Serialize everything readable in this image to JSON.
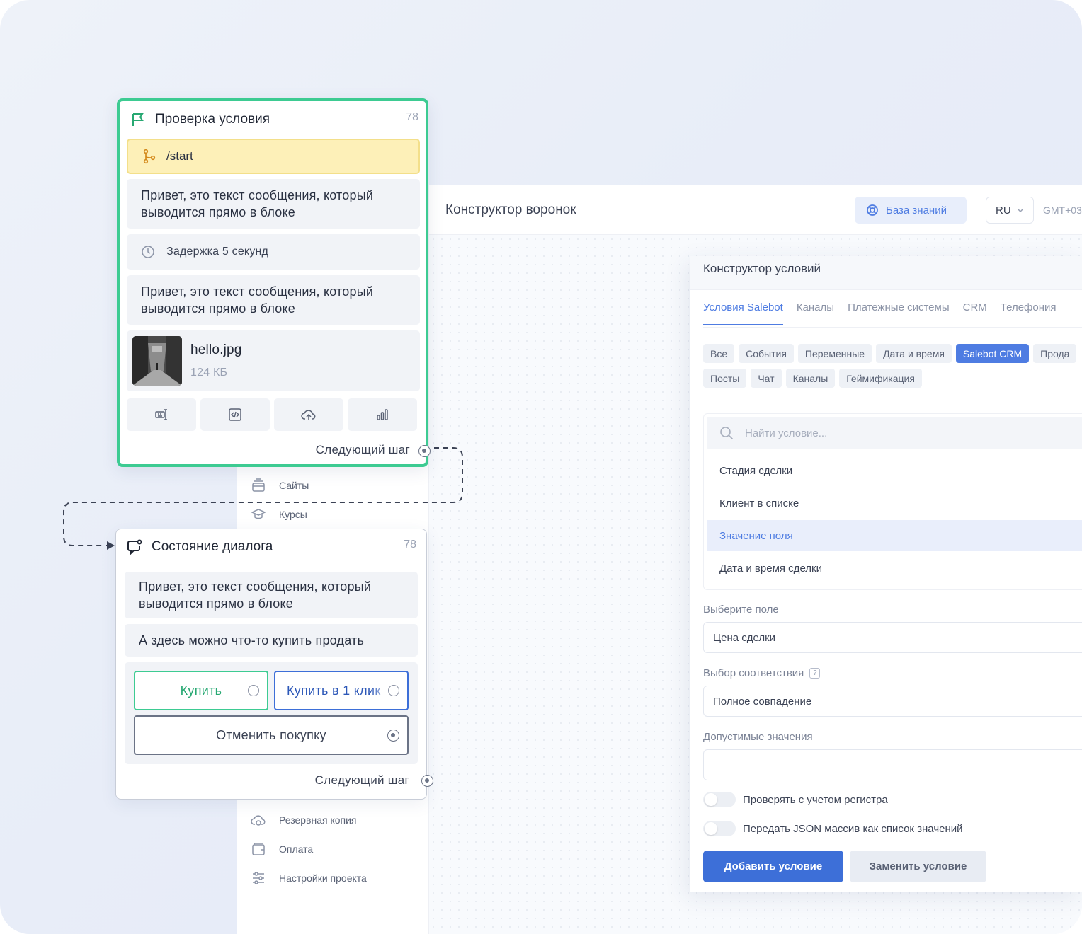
{
  "app": {
    "title": "Конструктор воронок",
    "knowledge_base_label": "База знаний",
    "language": "RU",
    "timezone": "GMT+03"
  },
  "sidebar": {
    "items": [
      {
        "label": "Сайты",
        "icon": "stack-icon"
      },
      {
        "label": "Курсы",
        "icon": "graduation-cap-icon"
      },
      {
        "label": "Резервная копия",
        "icon": "cloud-backup-icon"
      },
      {
        "label": "Оплата",
        "icon": "wallet-icon"
      },
      {
        "label": "Настройки проекта",
        "icon": "sliders-icon"
      }
    ]
  },
  "conditions": {
    "title": "Конструктор условий",
    "tabs": [
      "Условия Salebot",
      "Каналы",
      "Платежные системы",
      "CRM",
      "Телефония"
    ],
    "active_tab": "Условия Salebot",
    "chips": [
      "Все",
      "События",
      "Переменные",
      "Дата и время",
      "Salebot CRM",
      "Прода",
      "Посты",
      "Чат",
      "Каналы",
      "Геймификация"
    ],
    "active_chip": "Salebot CRM",
    "search_placeholder": "Найти условие...",
    "options": [
      "Стадия сделки",
      "Клиент в списке",
      "Значение поля",
      "Дата и время сделки"
    ],
    "selected_option": "Значение поля",
    "field_label": "Выберите поле",
    "field_value": "Цена сделки",
    "match_label": "Выбор соответствия",
    "match_help": "?",
    "match_value": "Полное совпадение",
    "allowed_label": "Допустимые значения",
    "allowed_value": "",
    "toggle_case_label": "Проверять с учетом регистра",
    "toggle_json_label": "Передать JSON массив как список значений",
    "add_button": "Добавить условие",
    "replace_button": "Заменить условие"
  },
  "card_check": {
    "title": "Проверка условия",
    "number": "78",
    "trigger": "/start",
    "message_1": "Привет, это текст сообщения, который выводится прямо в блоке",
    "delay": "Задержка 5 секунд",
    "message_2": "Привет, это текст сообщения, который выводится прямо в блоке",
    "file_name": "hello.jpg",
    "file_size": "124 КБ",
    "next_step": "Следующий шаг"
  },
  "card_dialog": {
    "title": "Состояние диалога",
    "number": "78",
    "message_1": "Привет, это текст сообщения, который выводится прямо в блоке",
    "message_2": "А здесь можно что-то купить продать",
    "button_buy": "Купить",
    "button_buy_one_click": "Купить в 1 клик",
    "button_cancel": "Отменить покупку",
    "next_step": "Следующий шаг"
  },
  "colors": {
    "accent": "#4e7ce2",
    "card_border_active": "#3dcb92",
    "trigger_bg": "#fdf0b8",
    "buy_border": "#3dcb92",
    "buy_text": "#27a872",
    "buy_one_click_border": "#3d6fd8"
  }
}
